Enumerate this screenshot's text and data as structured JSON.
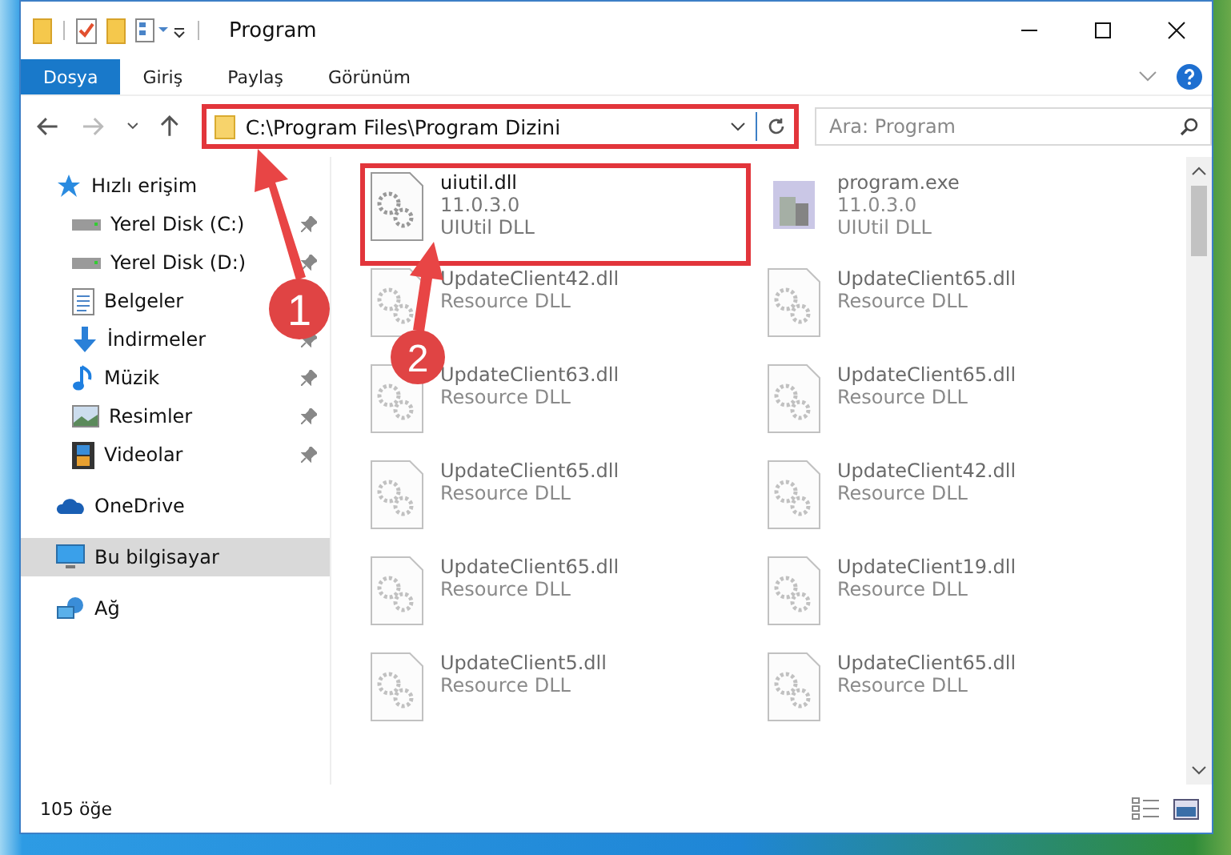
{
  "window": {
    "title": "Program"
  },
  "ribbon": {
    "tabs": [
      {
        "label": "Dosya",
        "selected": true
      },
      {
        "label": "Giriş",
        "selected": false
      },
      {
        "label": "Paylaş",
        "selected": false
      },
      {
        "label": "Görünüm",
        "selected": false
      }
    ]
  },
  "address": {
    "path": "C:\\Program Files\\Program Dizini",
    "highlighted": true
  },
  "search": {
    "placeholder": "Ara: Program"
  },
  "nav": {
    "items": [
      {
        "label": "Hızlı erişim",
        "kind": "quick",
        "selected": false,
        "children": [
          {
            "label": "Yerel Disk (C:)",
            "kind": "drive",
            "pinned": true,
            "selected": false
          },
          {
            "label": "Yerel Disk (D:)",
            "kind": "drive",
            "pinned": true,
            "selected": false
          },
          {
            "label": "Belgeler",
            "kind": "docs",
            "pinned": false,
            "selected": false
          },
          {
            "label": "İndirmeler",
            "kind": "downloads",
            "pinned": true,
            "selected": false
          },
          {
            "label": "Müzik",
            "kind": "music",
            "pinned": true,
            "selected": false
          },
          {
            "label": "Resimler",
            "kind": "pictures",
            "pinned": true,
            "selected": false
          },
          {
            "label": "Videolar",
            "kind": "videos",
            "pinned": true,
            "selected": false
          }
        ]
      },
      {
        "label": "OneDrive",
        "kind": "cloud",
        "selected": false
      },
      {
        "label": "Bu bilgisayar",
        "kind": "pc",
        "selected": true
      },
      {
        "label": "Ağ",
        "kind": "network",
        "selected": false
      }
    ]
  },
  "files": [
    {
      "name": "uiutil.dll",
      "lines": [
        "11.0.3.0",
        "UIUtil DLL"
      ],
      "kind": "dll",
      "blurred": false,
      "highlighted": true
    },
    {
      "name": "program.exe",
      "lines": [
        "11.0.3.0",
        "UIUtil DLL"
      ],
      "kind": "exe",
      "blurred": true,
      "highlighted": false
    },
    {
      "name": "UpdateClient42.dll",
      "lines": [
        "Resource DLL"
      ],
      "kind": "dll",
      "blurred": true,
      "highlighted": false
    },
    {
      "name": "UpdateClient65.dll",
      "lines": [
        "Resource DLL"
      ],
      "kind": "dll",
      "blurred": true,
      "highlighted": false
    },
    {
      "name": "UpdateClient63.dll",
      "lines": [
        "Resource DLL"
      ],
      "kind": "dll",
      "blurred": true,
      "highlighted": false
    },
    {
      "name": "UpdateClient65.dll",
      "lines": [
        "Resource DLL"
      ],
      "kind": "dll",
      "blurred": true,
      "highlighted": false
    },
    {
      "name": "UpdateClient65.dll",
      "lines": [
        "Resource DLL"
      ],
      "kind": "dll",
      "blurred": true,
      "highlighted": false
    },
    {
      "name": "UpdateClient42.dll",
      "lines": [
        "Resource DLL"
      ],
      "kind": "dll",
      "blurred": true,
      "highlighted": false
    },
    {
      "name": "UpdateClient65.dll",
      "lines": [
        "Resource DLL"
      ],
      "kind": "dll",
      "blurred": true,
      "highlighted": false
    },
    {
      "name": "UpdateClient19.dll",
      "lines": [
        "Resource DLL"
      ],
      "kind": "dll",
      "blurred": true,
      "highlighted": false
    },
    {
      "name": "UpdateClient5.dll",
      "lines": [
        "Resource DLL"
      ],
      "kind": "dll",
      "blurred": true,
      "highlighted": false
    },
    {
      "name": "UpdateClient65.dll",
      "lines": [
        "Resource DLL"
      ],
      "kind": "dll",
      "blurred": true,
      "highlighted": false
    }
  ],
  "status_bar": {
    "count": "105 öğe"
  },
  "annotations": [
    {
      "number": "1"
    },
    {
      "number": "2"
    }
  ]
}
